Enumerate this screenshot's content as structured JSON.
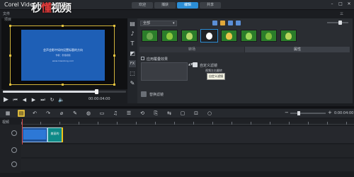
{
  "app": {
    "title": "Corel VideoStudio X10",
    "watermark_prefix": "秒",
    "watermark_accent": "懂",
    "watermark_suffix": "视频"
  },
  "tabs": [
    {
      "label": "欢迎",
      "active": false
    },
    {
      "label": "捕获",
      "active": false
    },
    {
      "label": "编辑",
      "active": true
    },
    {
      "label": "共享",
      "active": false
    }
  ],
  "window_controls": {
    "minimize": "–",
    "maximize": "□",
    "close": "✕"
  },
  "menu": {
    "file": "文件",
    "right": "三"
  },
  "preview": {
    "project_label": "项目",
    "line1": "会声会影中如何设置标题的方向",
    "line2": "作者：秒懂视频",
    "line3": "www.miaodong.com",
    "timecode": "00:00:04:00"
  },
  "transport": {
    "play": "▶",
    "prev": "⏮",
    "rewind": "◀",
    "forward": "▶",
    "next": "⏭",
    "loop": "↻",
    "volume": "🔈",
    "fullscreen": "⛶"
  },
  "library": {
    "dropdown": "全部",
    "dropdown_arrow": "▾",
    "subtabs": [
      "转场",
      "属性"
    ],
    "active_subtab": 1,
    "option_checkbox_label": "应用覆叠效果",
    "option_arrows": "▲▼",
    "option_label_1": "自定义滤镜",
    "option_label_2": "视频左右翻转",
    "tooltip": "自定义滤镜",
    "option_label_3": "替换滤镜"
  },
  "lib_icons": [
    "▤",
    "♪",
    "T",
    "◩",
    "FX",
    "⬚",
    "✎"
  ],
  "timeline": {
    "tools": [
      "▦",
      "▤",
      "↶",
      "↷",
      "⌀",
      "✎",
      "◍",
      "▭",
      "♫",
      "☰",
      "⟲",
      "⎘",
      "⇆",
      "▢",
      "⊡",
      "○"
    ],
    "active_tool": 1,
    "zoom_minus": "−",
    "zoom_plus": "+",
    "timecode": "0:00:04:00",
    "track_label": "视频",
    "clip_text": "美丽的",
    "zoom_level": 0.2
  },
  "colors": {
    "accent": "#2c8ed6",
    "highlight": "#d8b63b",
    "clip_blue": "#2d78d6",
    "clip_teal": "#0e8a88"
  }
}
